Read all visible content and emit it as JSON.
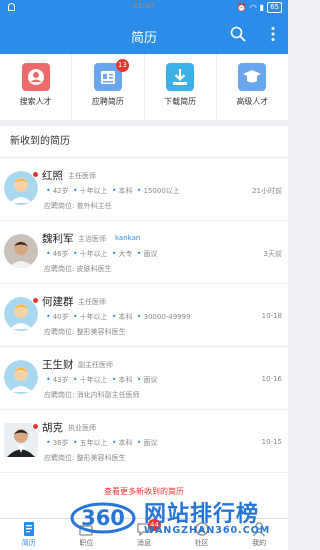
{
  "status_bar": {
    "time": "21:47",
    "battery": "65"
  },
  "app_bar": {
    "title": "简历"
  },
  "quick_actions": [
    {
      "label": "搜索人才",
      "icon": "search-person-icon",
      "color": "#ee6a6a",
      "badge": ""
    },
    {
      "label": "应聘简历",
      "icon": "resume-icon",
      "color": "#6aa6ee",
      "badge": "13"
    },
    {
      "label": "下载简历",
      "icon": "download-icon",
      "color": "#3db2e8",
      "badge": ""
    },
    {
      "label": "高级人才",
      "icon": "graduate-icon",
      "color": "#6aa6ee",
      "badge": ""
    }
  ],
  "list": {
    "title": "新收到的简历",
    "rows": [
      {
        "name": "红照",
        "title": "主任医师",
        "tag": "",
        "age": "42岁",
        "experience": "十年以上",
        "education": "本科",
        "salary": "15000以上",
        "job_label": "应聘岗位:",
        "job": "普外科主任",
        "time": "21小时前",
        "unread": true,
        "avatar": "default"
      },
      {
        "name": "魏利军",
        "title": "主治医师",
        "tag": "kankan",
        "age": "46岁",
        "experience": "十年以上",
        "education": "大专",
        "salary": "面议",
        "job_label": "应聘岗位:",
        "job": "皮肤科医生",
        "time": "3天前",
        "unread": false,
        "avatar": "photo"
      },
      {
        "name": "何建群",
        "title": "主任医师",
        "tag": "",
        "age": "40岁",
        "experience": "十年以上",
        "education": "本科",
        "salary": "30000-49999",
        "job_label": "应聘岗位:",
        "job": "整形美容科医生",
        "time": "10-18",
        "unread": true,
        "avatar": "default"
      },
      {
        "name": "王生财",
        "title": "副主任医师",
        "tag": "",
        "age": "43岁",
        "experience": "十年以上",
        "education": "本科",
        "salary": "面议",
        "job_label": "应聘岗位:",
        "job": "消化内科副主任医师",
        "time": "10-16",
        "unread": false,
        "avatar": "default"
      },
      {
        "name": "胡克",
        "title": "执业医师",
        "tag": "",
        "age": "36岁",
        "experience": "五年以上",
        "education": "本科",
        "salary": "面议",
        "job_label": "应聘岗位:",
        "job": "整形美容科医生",
        "time": "10-15",
        "unread": true,
        "avatar": "photo2"
      }
    ],
    "more_link": "查看更多新收到的简历"
  },
  "tab_bar": [
    {
      "label": "简历",
      "icon": "resume-tab-icon",
      "active": true,
      "badge": ""
    },
    {
      "label": "职位",
      "icon": "briefcase-icon",
      "active": false,
      "badge": ""
    },
    {
      "label": "消息",
      "icon": "chat-icon",
      "active": false,
      "badge": "44"
    },
    {
      "label": "社区",
      "icon": "community-icon",
      "active": false,
      "badge": ""
    },
    {
      "label": "我的",
      "icon": "person-icon",
      "active": false,
      "badge": ""
    }
  ],
  "watermark": {
    "logo_text": "360",
    "title": "网站排行榜",
    "url": "WANGZHAN360.COM"
  },
  "colors": {
    "primary": "#2c8de8",
    "badge": "#e8352e"
  }
}
